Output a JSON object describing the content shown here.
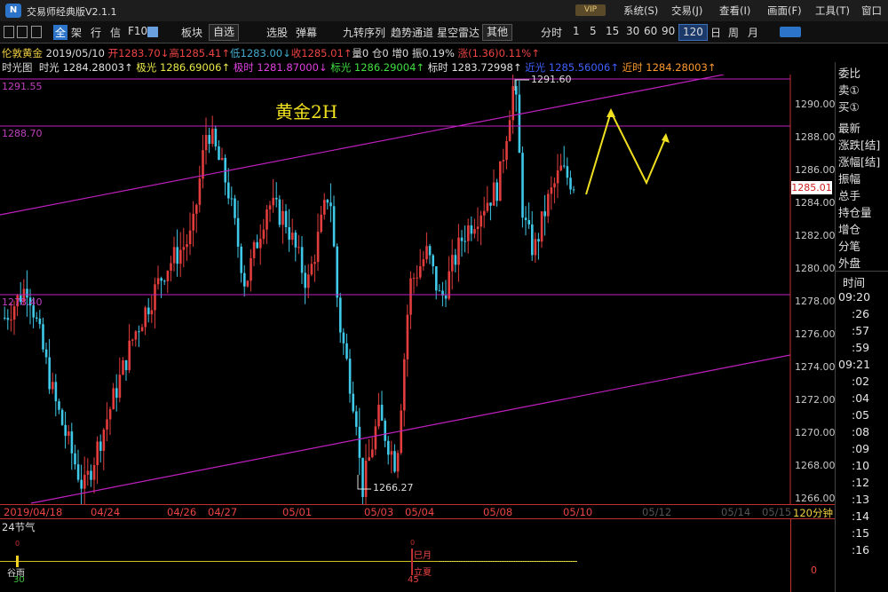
{
  "app": {
    "logo": "N",
    "title": "交易师经典版V2.1.1",
    "vip": "VIP",
    "menus": [
      "系统(S)",
      "交易(J)",
      "查看(I)",
      "画面(F)",
      "工具(T)",
      "窗口"
    ]
  },
  "toolbar": {
    "icons": [
      "全",
      "架",
      "行",
      "信",
      "F10",
      "板块"
    ],
    "select_label": "自选",
    "items": [
      "选股",
      "弹幕",
      "九转序列",
      "趋势通道",
      "星空雷达"
    ],
    "other_label": "其他",
    "period_label": "分时",
    "periods": [
      "1",
      "5",
      "15",
      "30",
      "60",
      "90",
      "120",
      "日",
      "周",
      "月"
    ],
    "active_period": "120",
    "colors": {
      "active_bg": "#1b3a6a"
    }
  },
  "quote": {
    "name": "伦敦黄金",
    "date": "2019/05/10",
    "open": "开1283.70↓",
    "high": "高1285.41↑",
    "low": "低1283.00↓",
    "close": "收1285.01↑",
    "volume": "量0",
    "oi": "仓0",
    "inc": "增0",
    "amp": "振0.19%",
    "change": "涨(1.36)0.11%↑"
  },
  "indicators": {
    "title": "时光图",
    "items": [
      {
        "label": "时光",
        "value": "1284.28003↑",
        "color": "#e0e0e0"
      },
      {
        "label": "极光",
        "value": "1286.69006↑",
        "color": "#e8e84a"
      },
      {
        "label": "极时",
        "value": "1281.87000↓",
        "color": "#e040e0"
      },
      {
        "label": "标光",
        "value": "1286.29004↑",
        "color": "#40e040"
      },
      {
        "label": "标时",
        "value": "1283.72998↑",
        "color": "#e0e0e0"
      },
      {
        "label": "近光",
        "value": "1285.56006↑",
        "color": "#4060ff"
      },
      {
        "label": "近时",
        "value": "1284.28003↑",
        "color": "#ff9b2e"
      }
    ]
  },
  "chart": {
    "title": "黄金2H",
    "level_labels": [
      "1291.55",
      "1288.70",
      "1278.40"
    ],
    "annotations": [
      "1291.60",
      "1266.27"
    ],
    "current_price": "1285.01",
    "axis_ticks": [
      "1290.00",
      "1288.00",
      "1286.00",
      "1284.00",
      "1282.00",
      "1280.00",
      "1278.00",
      "1276.00",
      "1274.00",
      "1272.00",
      "1270.00",
      "1268.00",
      "1266.00"
    ],
    "period_label": "120分钟",
    "dates": [
      "2019/04/18",
      "04/24",
      "04/26",
      "04/27",
      "05/01",
      "05/03",
      "05/04",
      "05/08",
      "05/10",
      "05/12",
      "05/14",
      "05/15"
    ],
    "up_color": "#e23c3c",
    "down_color": "#3fc8e8",
    "line_color": "#c020c0",
    "arrow_color": "#f0e020"
  },
  "lower_pane": {
    "title": "24节气",
    "markers": [
      {
        "top": "0",
        "label": "谷雨",
        "num": "30"
      },
      {
        "top": "0",
        "label": "巳月",
        "sub": "立夏",
        "num": "45"
      }
    ],
    "right_value": "0"
  },
  "right_panel": {
    "items": [
      "委比",
      "卖①",
      "买①",
      "最新",
      "涨跌[结]",
      "涨幅[结]",
      "振幅",
      "总手",
      "持仓量",
      "增仓",
      "分笔",
      "外盘"
    ],
    "time_header": "时间",
    "times": [
      "09:20",
      ":26",
      ":57",
      ":59",
      "09:21",
      ":02",
      ":04",
      ":05",
      ":08",
      ":09",
      ":10",
      ":12",
      ":13",
      ":14",
      ":15",
      ":16"
    ]
  }
}
